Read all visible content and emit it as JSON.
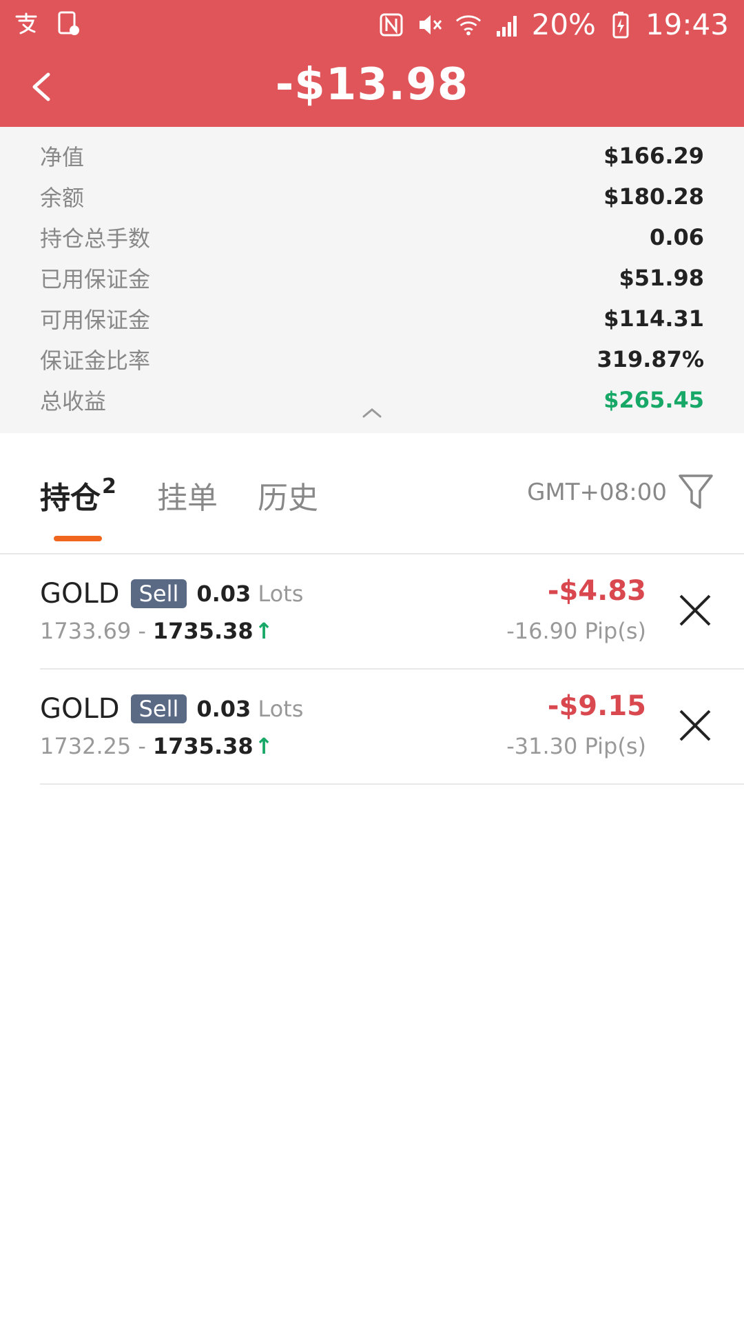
{
  "status_bar": {
    "battery": "20%",
    "time": "19:43"
  },
  "header": {
    "title": "-$13.98",
    "colors": {
      "background": "#e0555a",
      "text": "#ffffff"
    }
  },
  "summary": {
    "rows": [
      {
        "label": "净值",
        "value": "$166.29"
      },
      {
        "label": "余额",
        "value": "$180.28"
      },
      {
        "label": "持仓总手数",
        "value": "0.06"
      },
      {
        "label": "已用保证金",
        "value": "$51.98"
      },
      {
        "label": "可用保证金",
        "value": "$114.31"
      },
      {
        "label": "保证金比率",
        "value": "319.87%"
      },
      {
        "label": "总收益",
        "value": "$265.45"
      }
    ],
    "positive_color": "#17a867"
  },
  "tabs": {
    "items": [
      {
        "label": "持仓",
        "badge": "2"
      },
      {
        "label": "挂单"
      },
      {
        "label": "历史"
      }
    ],
    "active": 0,
    "timezone": "GMT+08:00",
    "accent": "#f0661f"
  },
  "positions": [
    {
      "symbol": "GOLD",
      "side": "Sell",
      "lots": "0.03",
      "lots_unit": "Lots",
      "open_price": "1733.69",
      "separator": "-",
      "current_price": "1735.38",
      "pnl": "-$4.83",
      "pips": "-16.90 Pip(s)"
    },
    {
      "symbol": "GOLD",
      "side": "Sell",
      "lots": "0.03",
      "lots_unit": "Lots",
      "open_price": "1732.25",
      "separator": "-",
      "current_price": "1735.38",
      "pnl": "-$9.15",
      "pips": "-31.30 Pip(s)"
    }
  ],
  "icons": {
    "back": "back-arrow-icon",
    "collapse": "chevron-up-icon",
    "filter": "filter-icon",
    "close": "close-icon",
    "trend": "arrow-up-icon"
  }
}
